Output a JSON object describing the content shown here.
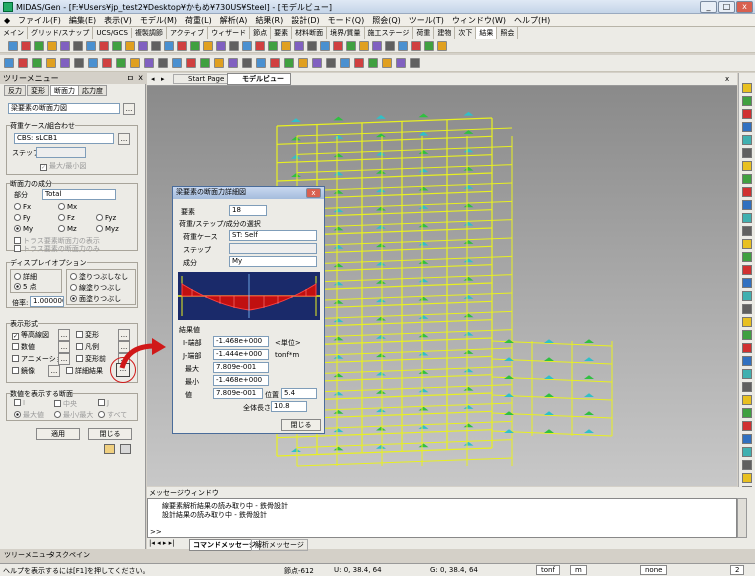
{
  "titlebar": {
    "title": "MIDAS/Gen - [F:¥Users¥jp_test2¥Desktop¥かもめ¥730US¥Steel] - [モデルビュー]"
  },
  "menu": [
    "ファイル(F)",
    "編集(E)",
    "表示(V)",
    "モデル(M)",
    "荷重(L)",
    "解析(A)",
    "結果(R)",
    "設計(D)",
    "モード(Q)",
    "照会(Q)",
    "ツール(T)",
    "ウィンドウ(W)",
    "ヘルプ(H)"
  ],
  "ribbon_tabs": [
    "メイン",
    "グリッド/スナップ",
    "UCS/GCS",
    "複製調節",
    "アクティブ",
    "ウィザード",
    "節点",
    "要素",
    "材料断面",
    "境界/質量",
    "施工ステージ",
    "荷重",
    "建物",
    "次下",
    "結果",
    "照会"
  ],
  "tree": {
    "title": "ツリーメニュー",
    "pin": "ㅁ",
    "close": "x",
    "tabs": [
      "反力",
      "変形",
      "断面力",
      "応力度"
    ],
    "combo": "梁要素の断面力図",
    "combo_btn": "...",
    "load_group": "荷重ケース/組合わせ",
    "load_case": "CBS: sLCB1",
    "step_label": "ステップ",
    "maxmin": "最大/最小図",
    "comp_group": "断面力の成分",
    "part_label": "部分",
    "part": "Total",
    "radios": [
      "Fx",
      "Mx",
      "Fy",
      "Fz",
      "Fyz",
      "My",
      "Mz",
      "Myz"
    ],
    "truss1": "トラス要素断面力の表示",
    "truss2": "トラス要素の断面力のみ",
    "disp_group": "ディスプレイオプション",
    "detail": "詳細",
    "five": "5 点",
    "nofill": "塗りつぶしなし",
    "line": "線塗りつぶし",
    "surface": "面塗りつぶし",
    "scale_label": "倍率:",
    "scale": "1.000000",
    "show_group": "表示形式",
    "contour": "等高線図",
    "deform": "変形",
    "value": "数値",
    "legend": "凡例",
    "anim": "アニメーション",
    "undeform": "変形前",
    "mirror": "鏡像",
    "detail_result": "詳細結果",
    "sec_group": "数値を表示する断面",
    "i": "I",
    "mid": "中央",
    "j": "J",
    "max": "最大値",
    "maxmin2": "最小/最大",
    "all": "すべて",
    "apply": "適用",
    "close_btn": "閉じる",
    "bottom_tabs": [
      "ツリーメニュー",
      "タスクペイン"
    ]
  },
  "doc": {
    "tabs": [
      "Start Page",
      "モデルビュー"
    ]
  },
  "dialog": {
    "title": "梁要素の断面力詳細図",
    "elem_label": "要素",
    "elem": "18",
    "sel_group": "荷重/ステップ/成分の選択",
    "lc_label": "荷重ケース",
    "lc": "ST: Self",
    "step_label": "ステップ",
    "comp_label": "成分",
    "comp": "My",
    "res_group": "結果値",
    "i_label": "I-端部",
    "i_val": "-1.468e+000",
    "j_label": "J-端部",
    "j_val": "-1.444e+000",
    "max_label": "最大",
    "max_val": "7.809e-001",
    "min_label": "最小",
    "min_val": "-1.468e+000",
    "v_label": "値",
    "v_val": "7.809e-001",
    "pos_label": "位置",
    "pos": "5.4",
    "unit_label": "<単位>",
    "unit": "tonf*m",
    "len_label": "全体長さ",
    "len": "10.8",
    "close": "閉じる"
  },
  "msg": {
    "title": "メッセージウィンドウ",
    "lines": [
      "線要素解析結果の読み取り中 - 鉄骨設計",
      "設計結果の読み取り中 - 鉄骨設計"
    ],
    "prompt": ">>",
    "tabs": [
      "コマンドメッセージ",
      "解析メッセージ"
    ]
  },
  "status": {
    "help": "ヘルプを表示するには[F1]を押してください。",
    "node": "節点-612",
    "u": "U: 0, 38.4, 64",
    "g": "G: 0, 38.4, 64",
    "unit1": "tonf",
    "unit2": "m",
    "unit3": "none",
    "page": "2"
  },
  "colors": {
    "accent": "#316ac5",
    "frame": "#e8f020",
    "contour_green": "#30c040",
    "contour_cyan": "#30c0c8",
    "bend_red": "#d01818"
  }
}
